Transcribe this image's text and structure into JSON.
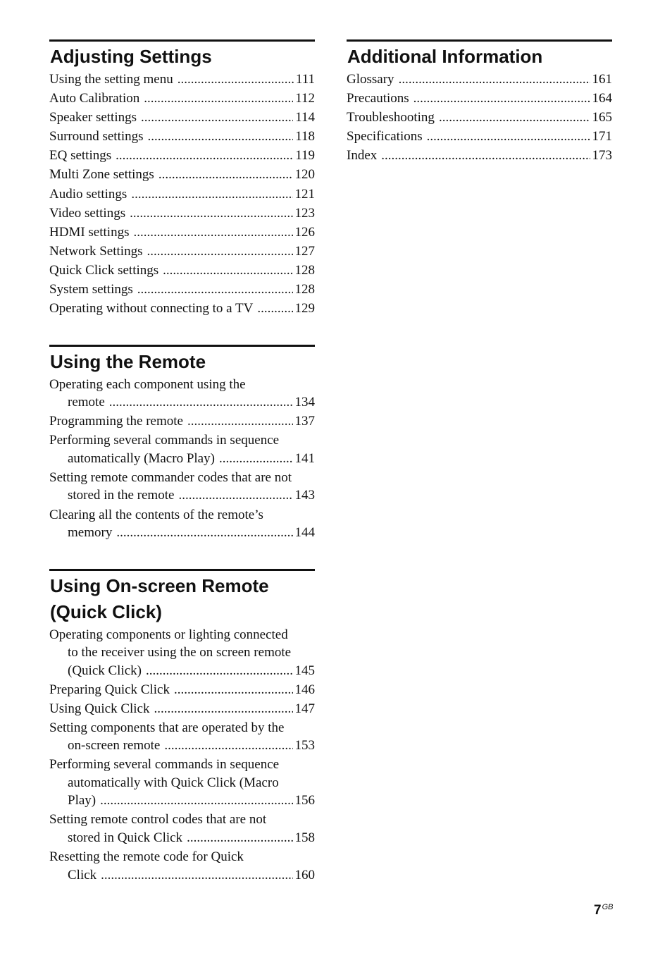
{
  "left_sections": [
    {
      "title": "Adjusting Settings",
      "entries": [
        {
          "lines": [
            "Using the setting menu"
          ],
          "page": "111"
        },
        {
          "lines": [
            "Auto Calibration"
          ],
          "page": "112"
        },
        {
          "lines": [
            "Speaker settings"
          ],
          "page": "114"
        },
        {
          "lines": [
            "Surround settings"
          ],
          "page": "118"
        },
        {
          "lines": [
            "EQ settings"
          ],
          "page": "119"
        },
        {
          "lines": [
            "Multi Zone settings"
          ],
          "page": "120"
        },
        {
          "lines": [
            "Audio settings"
          ],
          "page": "121"
        },
        {
          "lines": [
            "Video settings"
          ],
          "page": "123"
        },
        {
          "lines": [
            "HDMI settings"
          ],
          "page": "126"
        },
        {
          "lines": [
            "Network Settings"
          ],
          "page": "127"
        },
        {
          "lines": [
            "Quick Click settings"
          ],
          "page": "128"
        },
        {
          "lines": [
            "System settings"
          ],
          "page": "128"
        },
        {
          "lines": [
            "Operating without connecting to a TV"
          ],
          "page": "129"
        }
      ]
    },
    {
      "title": "Using the Remote",
      "entries": [
        {
          "lines": [
            "Operating each component using the",
            "remote"
          ],
          "page": "134"
        },
        {
          "lines": [
            "Programming the remote"
          ],
          "page": "137"
        },
        {
          "lines": [
            "Performing several commands in sequence",
            "automatically (Macro Play)"
          ],
          "page": "141"
        },
        {
          "lines": [
            "Setting remote commander codes that are not",
            "stored in the remote"
          ],
          "page": "143"
        },
        {
          "lines": [
            "Clearing all the contents of the remote’s",
            "memory"
          ],
          "page": "144"
        }
      ]
    },
    {
      "title_lines": [
        "Using On-screen Remote",
        "(Quick Click)"
      ],
      "entries": [
        {
          "lines": [
            "Operating components or lighting connected",
            "to the receiver using the on screen remote",
            "(Quick Click)"
          ],
          "page": "145"
        },
        {
          "lines": [
            "Preparing Quick Click"
          ],
          "page": "146"
        },
        {
          "lines": [
            "Using Quick Click"
          ],
          "page": "147"
        },
        {
          "lines": [
            "Setting components that are operated by the",
            "on-screen remote"
          ],
          "page": "153"
        },
        {
          "lines": [
            "Performing several commands in sequence",
            "automatically with Quick Click (Macro",
            "Play)"
          ],
          "page": "156"
        },
        {
          "lines": [
            "Setting remote control codes that are not",
            "stored in Quick Click"
          ],
          "page": "158"
        },
        {
          "lines": [
            "Resetting the remote code for Quick",
            "Click"
          ],
          "page": "160"
        }
      ]
    }
  ],
  "right_sections": [
    {
      "title": "Additional Information",
      "entries": [
        {
          "lines": [
            "Glossary"
          ],
          "page": "161"
        },
        {
          "lines": [
            "Precautions"
          ],
          "page": "164"
        },
        {
          "lines": [
            "Troubleshooting"
          ],
          "page": "165"
        },
        {
          "lines": [
            "Specifications"
          ],
          "page": "171"
        },
        {
          "lines": [
            "Index"
          ],
          "page": "173"
        }
      ]
    }
  ],
  "footer": {
    "page_number": "7",
    "page_suffix": "GB"
  }
}
